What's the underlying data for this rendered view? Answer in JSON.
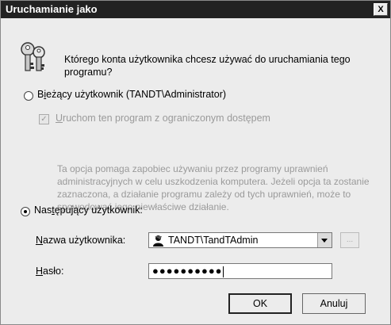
{
  "window": {
    "title": "Uruchamianie jako",
    "close_label": "X"
  },
  "question": "Którego konta użytkownika chcesz używać do uruchamiania tego programu?",
  "current_user": {
    "selected": false,
    "prefix": "B",
    "underlined": "i",
    "rest": "eżący użytkownik (TANDT\\Administrator)"
  },
  "restricted": {
    "checked": true,
    "underlined": "U",
    "rest": "ruchom ten program z ograniczonym dostępem"
  },
  "help_text": "Ta opcja pomaga zapobiec używaniu przez programy uprawnień administracyjnych w celu uszkodzenia komputera. Jeżeli opcja ta zostanie zaznaczona, a działanie programu zależy od tych uprawnień, może to spowodować jego niewłaściwe działanie.",
  "following_user": {
    "selected": true,
    "prefix": "Nas",
    "underlined": "t",
    "rest": "ępujący użytkownik:"
  },
  "username": {
    "underlined": "N",
    "rest": "azwa użytkownika:",
    "value": "TANDT\\TandTAdmin",
    "browse_label": "..."
  },
  "password": {
    "underlined": "H",
    "rest": "asło:",
    "value": "●●●●●●●●●●"
  },
  "buttons": {
    "ok": "OK",
    "cancel": "Anuluj"
  },
  "colors": {
    "titlebar": "#222222",
    "dialog_bg": "#ececec",
    "disabled_text": "#9a9a9a"
  }
}
